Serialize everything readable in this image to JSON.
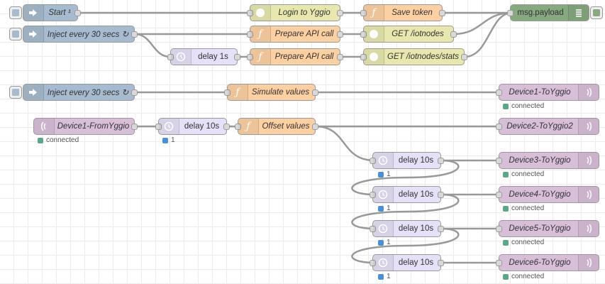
{
  "flow": {
    "nodes": {
      "start": {
        "label": "Start ¹",
        "type": "inject"
      },
      "login": {
        "label": "Login to Yggio",
        "type": "http"
      },
      "save_token": {
        "label": "Save token",
        "type": "function"
      },
      "debug": {
        "label": "msg.payload",
        "type": "debug"
      },
      "inject1": {
        "label": "Inject every 30 secs ↻",
        "type": "inject"
      },
      "prep1": {
        "label": "Prepare API call",
        "type": "function"
      },
      "get1": {
        "label": "GET /iotnodes",
        "type": "http"
      },
      "delay1s": {
        "label": "delay 1s",
        "type": "delay"
      },
      "prep2": {
        "label": "Prepare API call",
        "type": "function"
      },
      "get2": {
        "label": "GET /iotnodes/stats",
        "type": "http"
      },
      "inject2": {
        "label": "Inject every 30 secs ↻",
        "type": "inject"
      },
      "simulate": {
        "label": "Simulate values",
        "type": "function"
      },
      "dev1to": {
        "label": "Device1-ToYggio",
        "type": "mqtt-out",
        "status": "connected"
      },
      "dev1from": {
        "label": "Device1-FromYggio",
        "type": "mqtt-in",
        "status": "connected"
      },
      "delay10a": {
        "label": "delay 10s",
        "type": "delay",
        "status": "1"
      },
      "offset": {
        "label": "Offset values",
        "type": "function"
      },
      "dev2to": {
        "label": "Device2-ToYggio2",
        "type": "mqtt-out"
      },
      "delay10b": {
        "label": "delay 10s",
        "type": "delay",
        "status": "1"
      },
      "dev3to": {
        "label": "Device3-ToYggio",
        "type": "mqtt-out",
        "status": "connected"
      },
      "delay10c": {
        "label": "delay 10s",
        "type": "delay",
        "status": "1"
      },
      "dev4to": {
        "label": "Device4-ToYggio",
        "type": "mqtt-out",
        "status": "connected"
      },
      "delay10d": {
        "label": "delay 10s",
        "type": "delay",
        "status": "1"
      },
      "dev5to": {
        "label": "Device5-ToYggio",
        "type": "mqtt-out",
        "status": "connected"
      },
      "delay10e": {
        "label": "delay 10s",
        "type": "delay",
        "status": "1"
      },
      "dev6to": {
        "label": "Device6-ToYggio",
        "type": "mqtt-out",
        "status": "connected"
      }
    }
  },
  "colors": {
    "inject": "#a6bbcf",
    "function": "#fdd0a2",
    "http": "#e7e7ae",
    "delay": "#e6e0f8",
    "mqtt": "#d8bfd8",
    "debug": "#87a980",
    "wire": "#999999"
  }
}
